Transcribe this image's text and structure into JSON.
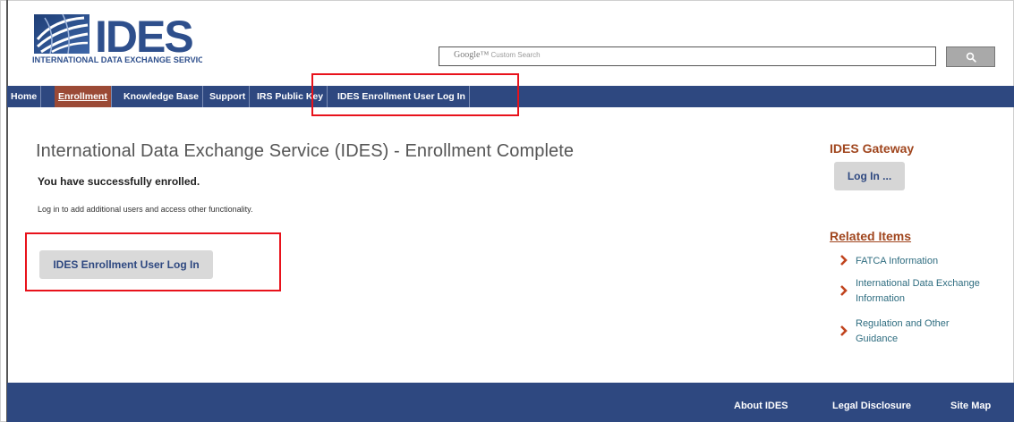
{
  "logo": {
    "wordmark": "IDES",
    "subtitle": "INTERNATIONAL DATA EXCHANGE SERVICE"
  },
  "search": {
    "placeholder_brand": "Google™",
    "placeholder_text": "Custom Search",
    "button_icon": "search-icon"
  },
  "nav": {
    "items": [
      {
        "label": "Home"
      },
      {
        "label": "Enrollment"
      },
      {
        "label": "Knowledge Base"
      },
      {
        "label": "Support"
      },
      {
        "label": "IRS Public Key"
      },
      {
        "label": "IDES Enrollment User Log In"
      }
    ],
    "active": "Enrollment"
  },
  "main": {
    "title": "International Data Exchange Service (IDES) - Enrollment Complete",
    "success_message": "You have successfully enrolled.",
    "info_message": "Log in to add additional users and access other functionality.",
    "login_button": "IDES Enrollment User Log In"
  },
  "sidebar": {
    "gateway_heading": "IDES Gateway",
    "gateway_button": "Log In ...",
    "related_heading": "Related Items",
    "related_items": [
      {
        "label": "FATCA Information"
      },
      {
        "label": "International Data Exchange Information"
      },
      {
        "label": "Regulation and Other Guidance"
      }
    ]
  },
  "footer": {
    "links": [
      {
        "label": "About IDES"
      },
      {
        "label": "Legal Disclosure"
      },
      {
        "label": "Site Map"
      }
    ]
  },
  "colors": {
    "nav_bg": "#2e4880",
    "nav_active": "#9b4a36",
    "sidebar_heading": "#a0461e",
    "related_link": "#2f6d80",
    "annotation": "#e8121b"
  }
}
